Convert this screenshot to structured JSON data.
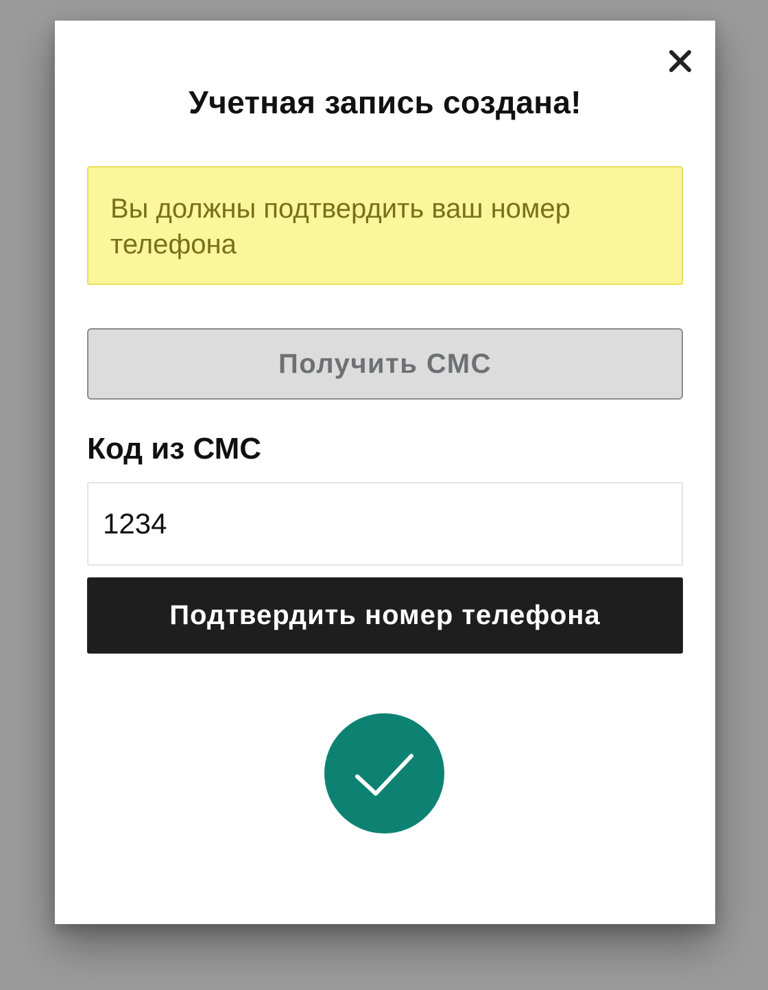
{
  "dialog": {
    "close_label": "×",
    "title": "Учетная запись создана!",
    "warning_text": "Вы должны подтвердить ваш номер телефона",
    "get_sms_label": "Получить СМС",
    "code_label": "Код из СМС",
    "code_value": "1234",
    "confirm_label": "Подтвердить номер телефона",
    "success_icon": "checkmark-icon"
  },
  "colors": {
    "overlay": "#9b9b9b",
    "warning_background": "#fbf69b",
    "warning_text": "#7a6f1b",
    "primary_button": "#1e1e1e",
    "secondary_button": "#dcdcdd",
    "success": "#0d8272"
  }
}
